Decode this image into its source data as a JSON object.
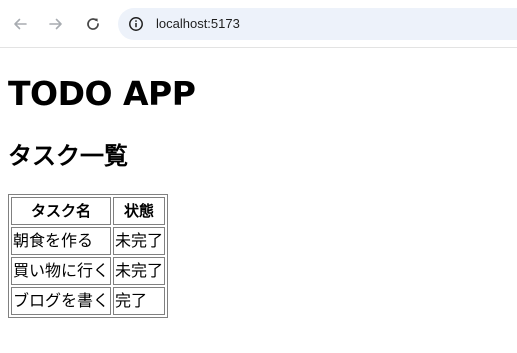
{
  "browser": {
    "url": "localhost:5173",
    "icons": {
      "back": "arrow-left-icon",
      "forward": "arrow-right-icon",
      "reload": "reload-icon",
      "site_info": "site-info-icon"
    }
  },
  "page": {
    "title": "TODO APP",
    "subtitle": "タスク一覧",
    "table": {
      "headers": [
        "タスク名",
        "状態"
      ],
      "rows": [
        {
          "name": "朝食を作る",
          "status": "未完了"
        },
        {
          "name": "買い物に行く",
          "status": "未完了"
        },
        {
          "name": "ブログを書く",
          "status": "完了"
        }
      ]
    }
  }
}
